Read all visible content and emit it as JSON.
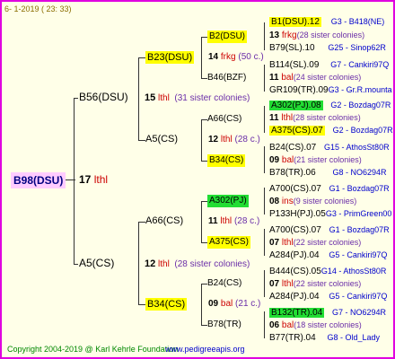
{
  "header": {
    "date_text": "6-  1-2019 ( 23: 33)"
  },
  "footer": {
    "copyright": "Copyright 2004-2019 @ Karl Kehrle Foundation",
    "website": "www.pedigreeapis.org"
  },
  "colors": {
    "frame": "#e000e0",
    "background": "#ffffe8",
    "yellow_box": "#ffff00",
    "green_box": "#22dd33",
    "sister_count": "#cc0000",
    "code": "#0000cc",
    "root_box": "#ffccff"
  },
  "root": {
    "name": "B98(DSU)",
    "gen": "17",
    "breeder": "lthl"
  },
  "g1": [
    {
      "name": "B56(DSU)",
      "gen": "15",
      "breeder": "lthl",
      "note": "(31 sister colonies)"
    },
    {
      "name": "A5(CS)",
      "gen": "12",
      "breeder": "lthl",
      "note": "(28 sister colonies)"
    }
  ],
  "g2": [
    {
      "name": "B23(DSU)",
      "gen": "14",
      "breeder": "frkg",
      "note": "(50 c.)"
    },
    {
      "name": "A5(CS)",
      "gen": "12",
      "breeder": "lthl",
      "note": "(28 c.)"
    },
    {
      "name": "A66(CS)",
      "gen": "11",
      "breeder": "lthl",
      "note": "(28 c.)"
    },
    {
      "name": "B34(CS)",
      "gen": "09",
      "breeder": "bal",
      "note": "(21 c.)"
    }
  ],
  "g3": [
    {
      "name": "B2(DSU)"
    },
    {
      "name": "B46(BZF)"
    },
    {
      "name": "A66(CS)"
    },
    {
      "name": "B34(CS)"
    },
    {
      "name": "A302(PJ)"
    },
    {
      "name": "A375(CS)"
    },
    {
      "name": "B24(CS)"
    },
    {
      "name": "B78(TR)"
    }
  ],
  "g4": [
    {
      "name": "B1(DSU).12",
      "code": "G3 - B418(NE)"
    },
    {
      "gen": "13",
      "breeder": "frkg",
      "note": "(28 sister colonies)"
    },
    {
      "name": "B79(SL).10",
      "code": "G25 - Sinop62R"
    },
    {
      "name": "B114(SL).09",
      "code": "G7 - Cankiri97Q"
    },
    {
      "gen": "11",
      "breeder": "bal",
      "note": "(24 sister colonies)"
    },
    {
      "name": "GR109(TR).09",
      "code": "G3 - Gr.R.mounta"
    },
    {
      "name": "A302(PJ).08",
      "code": "G2 - Bozdag07R"
    },
    {
      "gen": "11",
      "breeder": "lthl",
      "note": "(28 sister colonies)"
    },
    {
      "name": "A375(CS).07",
      "code": "G2 - Bozdag07R"
    },
    {
      "name": "B24(CS).07",
      "code": "G15 - AthosSt80R"
    },
    {
      "gen": "09",
      "breeder": "bal",
      "note": "(21 sister colonies)"
    },
    {
      "name": "B78(TR).06",
      "code": "G8 - NO6294R"
    },
    {
      "name": "A700(CS).07",
      "code": "G1 - Bozdag07R"
    },
    {
      "gen": "08",
      "breeder": "ins",
      "note": "(9 sister colonies)"
    },
    {
      "name": "P133H(PJ).05",
      "code": "G3 - PrimGreen00"
    },
    {
      "name": "A700(CS).07",
      "code": "G1 - Bozdag07R"
    },
    {
      "gen": "07",
      "breeder": "lthl",
      "note": "(22 sister colonies)"
    },
    {
      "name": "A284(PJ).04",
      "code": "G5 - Cankiri97Q"
    },
    {
      "name": "B444(CS).05",
      "code": "G14 - AthosSt80R"
    },
    {
      "gen": "07",
      "breeder": "lthl",
      "note": "(22 sister colonies)"
    },
    {
      "name": "A284(PJ).04",
      "code": "G5 - Cankiri97Q"
    },
    {
      "name": "B132(TR).04",
      "code": "G7 - NO6294R"
    },
    {
      "gen": "06",
      "breeder": "bal",
      "note": "(18 sister colonies)"
    },
    {
      "name": "B77(TR).04",
      "code": "G8 - Old_Lady"
    }
  ]
}
